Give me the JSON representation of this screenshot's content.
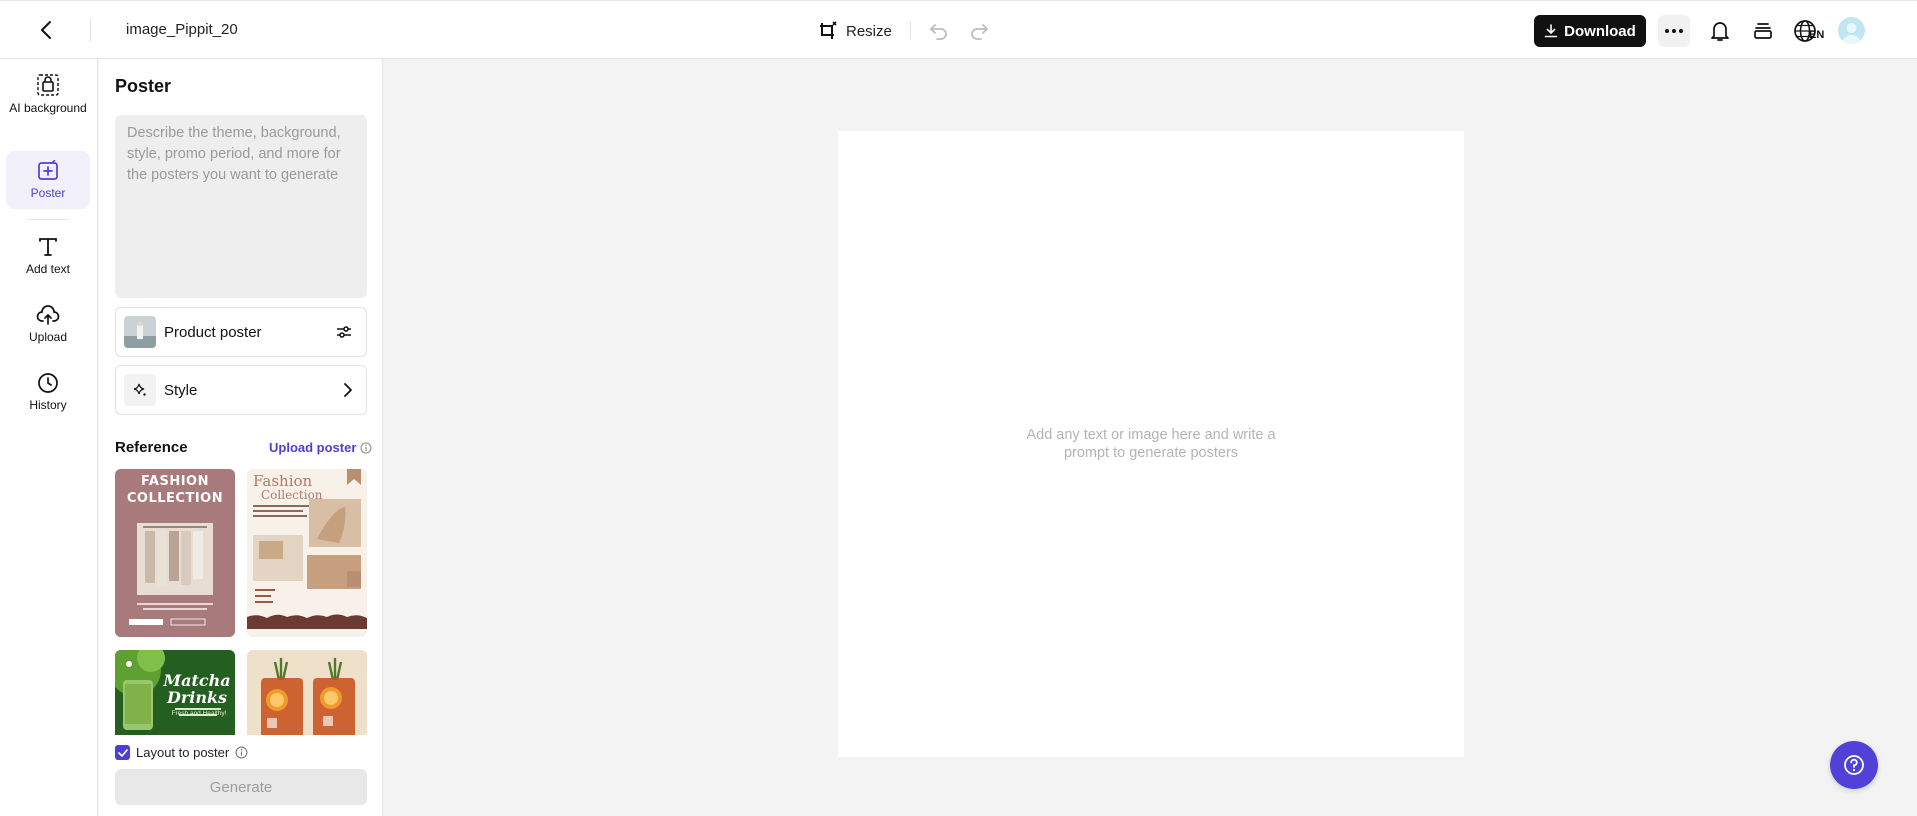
{
  "header": {
    "file_name": "image_Pippit_20",
    "resize_label": "Resize",
    "download_label": "Download",
    "language_code": "EN"
  },
  "rail": {
    "items": [
      {
        "label": "AI background",
        "icon": "ai-background-icon"
      },
      {
        "label": "Poster",
        "icon": "poster-icon",
        "active": true
      },
      {
        "label": "Add text",
        "icon": "text-icon"
      },
      {
        "label": "Upload",
        "icon": "upload-cloud-icon"
      },
      {
        "label": "History",
        "icon": "clock-icon"
      }
    ]
  },
  "panel": {
    "title": "Poster",
    "prompt_placeholder": "Describe the theme, background, style, promo period, and more for the posters you want to generate",
    "prompt_value": "",
    "product_poster_label": "Product poster",
    "style_label": "Style",
    "reference_title": "Reference",
    "upload_poster_label": "Upload poster",
    "reference_cards": [
      {
        "line1": "FASHION",
        "line2": "COLLECTION"
      },
      {
        "line1": "Fashion",
        "line2": "Collection"
      },
      {
        "line1": "Matcha",
        "line2": "Drinks",
        "line3": "Fresh and Healthy!"
      },
      {
        "line1": "",
        "line2": ""
      }
    ],
    "layout_label": "Layout to poster",
    "layout_checked": true,
    "generate_label": "Generate"
  },
  "canvas": {
    "hint_line1": "Add any text or image here and write a",
    "hint_line2": "prompt to generate posters"
  },
  "colors": {
    "accent": "#4d3fd6",
    "download_bg": "#111111",
    "help_bg": "#5141d9"
  }
}
